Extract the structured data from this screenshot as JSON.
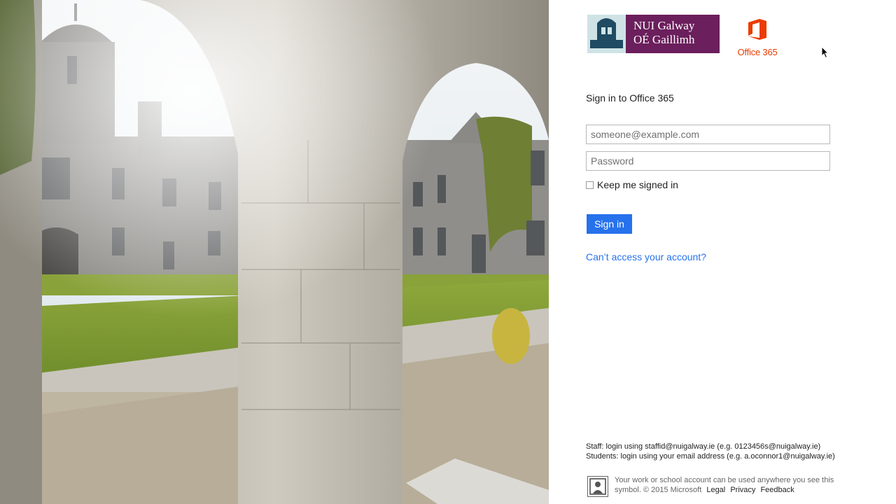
{
  "branding": {
    "university_line1": "NUI Galway",
    "university_line2": "OÉ Gaillimh",
    "product_name": "Office 365",
    "university_color": "#6b1f5c",
    "office_color": "#eb3c00"
  },
  "signin": {
    "title": "Sign in to Office 365",
    "email_placeholder": "someone@example.com",
    "email_value": "",
    "password_placeholder": "Password",
    "password_value": "",
    "keep_signed_in_label": "Keep me signed in",
    "keep_signed_in_checked": false,
    "sign_in_button": "Sign in",
    "cant_access_link": "Can’t access your account?",
    "accent_color": "#2672ec"
  },
  "instructions": {
    "staff": "Staff: login using staffid@nuigalway.ie (e.g. 0123456s@nuigalway.ie)",
    "students": "Students: login using your email address (e.g. a.oconnor1@nuigalway.ie)"
  },
  "footer": {
    "text": "Your work or school account can be used anywhere you see this symbol. © 2015 Microsoft",
    "legal": "Legal",
    "privacy": "Privacy",
    "feedback": "Feedback",
    "badge_icon": "office-account-symbol-icon"
  }
}
